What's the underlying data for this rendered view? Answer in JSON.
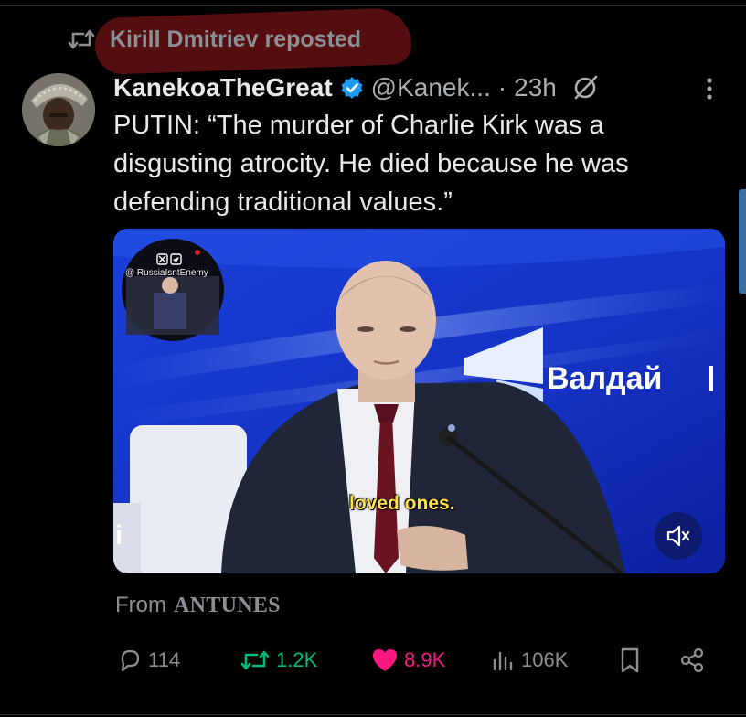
{
  "repost": {
    "icon": "repost-icon",
    "text": "Kirill Dmitriev reposted"
  },
  "post": {
    "display_name": "KanekoaTheGreat",
    "handle": "@Kanek...",
    "dot": "·",
    "time": "23h",
    "text": "PUTIN: “The murder of Charlie Kirk was a disgusting atrocity. He died because he was defending traditional values.”",
    "verified_color": "#1d9bf0"
  },
  "media": {
    "caption": "loved ones.",
    "watermark_handle": "@ RussiaIsntEnemy",
    "sign_text": "Валдай",
    "mute_icon": "muted-speaker-icon"
  },
  "from": {
    "label": "From",
    "source": "ANTUNES"
  },
  "actions": {
    "replies": "114",
    "reposts": "1.2K",
    "likes": "8.9K",
    "views": "106K"
  },
  "colors": {
    "repost_green": "#00ba7c",
    "like_pink": "#f91880",
    "muted_text": "#8b8f93",
    "background": "#000000"
  }
}
